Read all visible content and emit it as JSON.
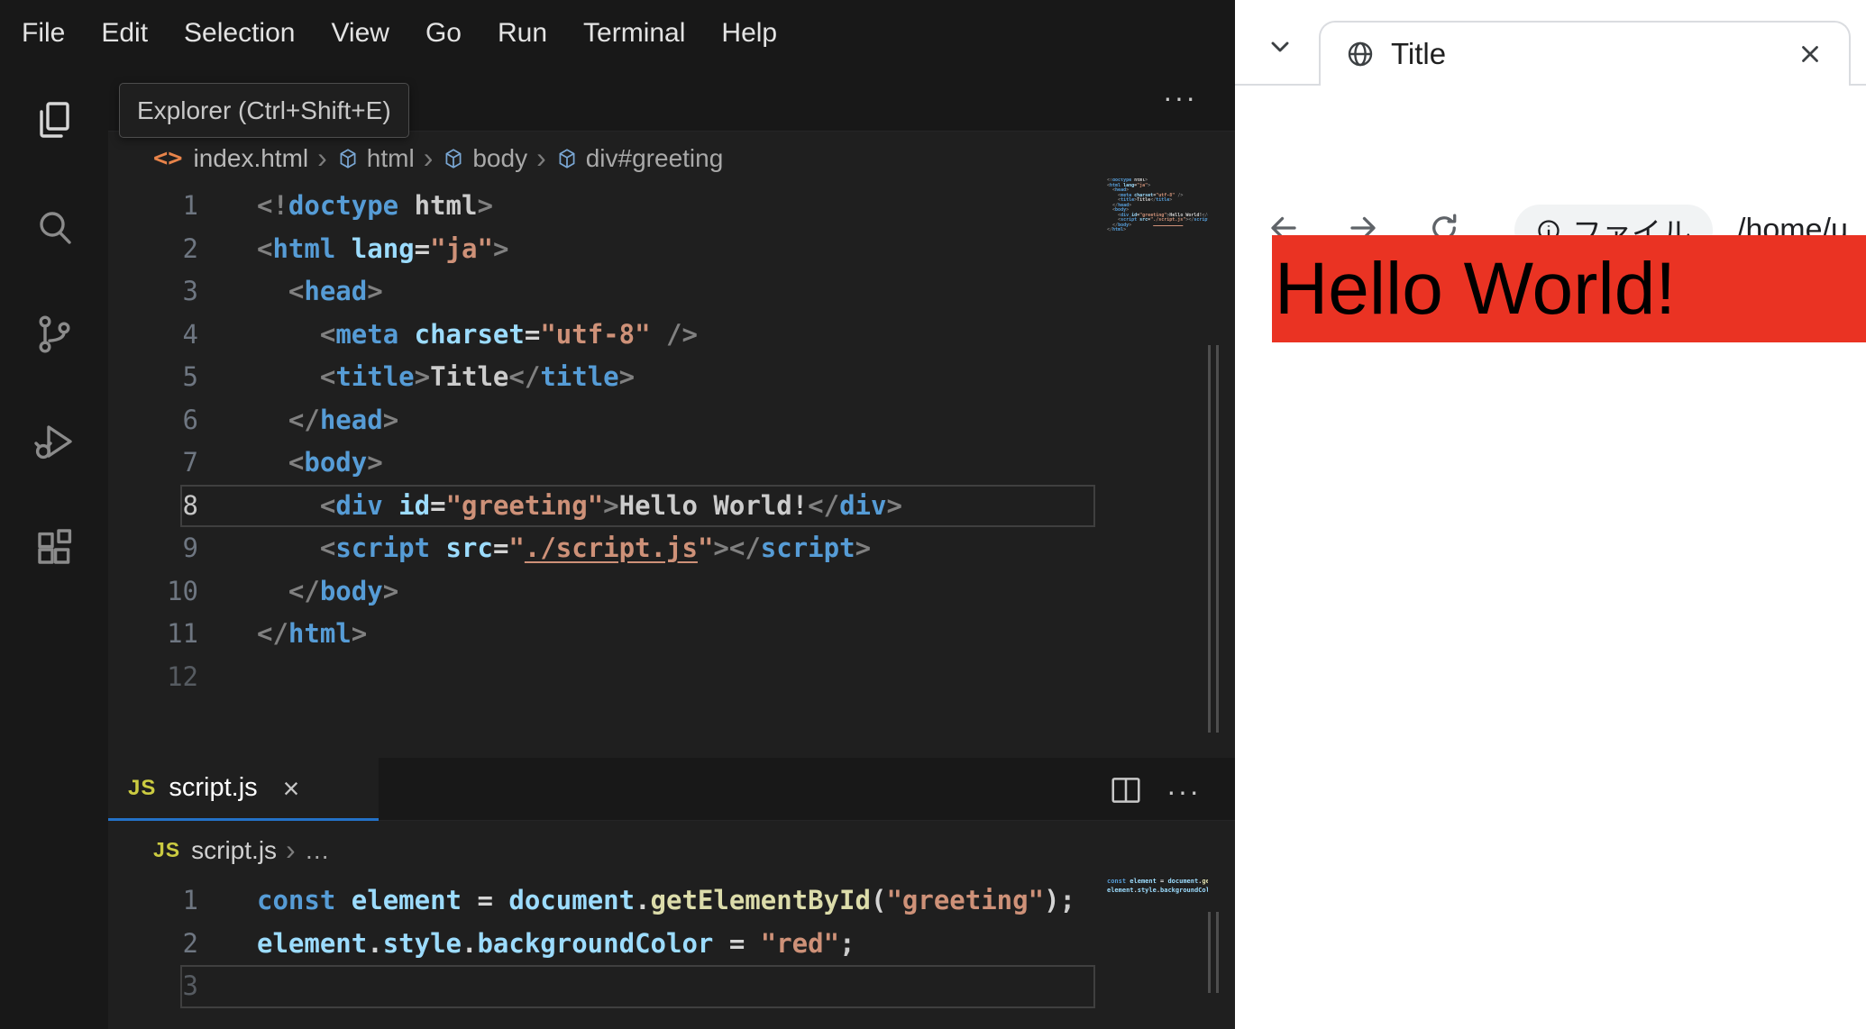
{
  "colors": {
    "accent_blue": "#2472c8",
    "banner_red": "#ea3323",
    "js_icon_yellow": "#cbcb41",
    "html_icon_orange": "#e8844a"
  },
  "vscode": {
    "menu": {
      "items": [
        "File",
        "Edit",
        "Selection",
        "View",
        "Go",
        "Run",
        "Terminal",
        "Help"
      ]
    },
    "activity_bar": {
      "tooltip": "Explorer (Ctrl+Shift+E)",
      "items": [
        "explorer",
        "search",
        "source-control",
        "run-and-debug",
        "extensions"
      ]
    },
    "ui": {
      "more": "···",
      "close_glyph": "×",
      "breadcrumb_separator": "›",
      "html_icon_glyph": "<>"
    },
    "html_editor": {
      "breadcrumb": {
        "file": "index.html",
        "path": [
          "html",
          "body",
          "div#greeting"
        ]
      },
      "lines": [
        {
          "n": "1",
          "tokens": [
            [
              "p",
              "<!"
            ],
            [
              "tag",
              "doctype"
            ],
            [
              "plain",
              " html"
            ],
            [
              "p",
              ">"
            ]
          ]
        },
        {
          "n": "2",
          "tokens": [
            [
              "p",
              "<"
            ],
            [
              "tag",
              "html"
            ],
            [
              "plain",
              " "
            ],
            [
              "attr",
              "lang"
            ],
            [
              "op",
              "="
            ],
            [
              "str",
              "\"ja\""
            ],
            [
              "p",
              ">"
            ]
          ]
        },
        {
          "n": "3",
          "tokens": [
            [
              "plain",
              "  "
            ],
            [
              "p",
              "<"
            ],
            [
              "tag",
              "head"
            ],
            [
              "p",
              ">"
            ]
          ]
        },
        {
          "n": "4",
          "tokens": [
            [
              "plain",
              "    "
            ],
            [
              "p",
              "<"
            ],
            [
              "tag",
              "meta"
            ],
            [
              "plain",
              " "
            ],
            [
              "attr",
              "charset"
            ],
            [
              "op",
              "="
            ],
            [
              "str",
              "\"utf-8\""
            ],
            [
              "plain",
              " "
            ],
            [
              "p",
              "/>"
            ]
          ]
        },
        {
          "n": "5",
          "tokens": [
            [
              "plain",
              "    "
            ],
            [
              "p",
              "<"
            ],
            [
              "tag",
              "title"
            ],
            [
              "p",
              ">"
            ],
            [
              "plain",
              "Title"
            ],
            [
              "p",
              "</"
            ],
            [
              "tag",
              "title"
            ],
            [
              "p",
              ">"
            ]
          ]
        },
        {
          "n": "6",
          "tokens": [
            [
              "plain",
              "  "
            ],
            [
              "p",
              "</"
            ],
            [
              "tag",
              "head"
            ],
            [
              "p",
              ">"
            ]
          ]
        },
        {
          "n": "7",
          "tokens": [
            [
              "plain",
              "  "
            ],
            [
              "p",
              "<"
            ],
            [
              "tag",
              "body"
            ],
            [
              "p",
              ">"
            ]
          ]
        },
        {
          "n": "8",
          "current": true,
          "tokens": [
            [
              "plain",
              "    "
            ],
            [
              "p",
              "<"
            ],
            [
              "tag",
              "div"
            ],
            [
              "plain",
              " "
            ],
            [
              "attr",
              "id"
            ],
            [
              "op",
              "="
            ],
            [
              "str",
              "\"greeting\""
            ],
            [
              "p",
              ">"
            ],
            [
              "plain",
              "Hello World!"
            ],
            [
              "p",
              "</"
            ],
            [
              "tag",
              "div"
            ],
            [
              "p",
              ">"
            ]
          ]
        },
        {
          "n": "9",
          "tokens": [
            [
              "plain",
              "    "
            ],
            [
              "p",
              "<"
            ],
            [
              "tag",
              "script"
            ],
            [
              "plain",
              " "
            ],
            [
              "attr",
              "src"
            ],
            [
              "op",
              "="
            ],
            [
              "str",
              "\""
            ],
            [
              "link",
              "./script.js"
            ],
            [
              "str",
              "\""
            ],
            [
              "p",
              "></"
            ],
            [
              "tag",
              "script"
            ],
            [
              "p",
              ">"
            ]
          ]
        },
        {
          "n": "10",
          "tokens": [
            [
              "plain",
              "  "
            ],
            [
              "p",
              "</"
            ],
            [
              "tag",
              "body"
            ],
            [
              "p",
              ">"
            ]
          ]
        },
        {
          "n": "11",
          "tokens": [
            [
              "p",
              "</"
            ],
            [
              "tag",
              "html"
            ],
            [
              "p",
              ">"
            ]
          ]
        },
        {
          "n": "12",
          "dim": true,
          "tokens": []
        }
      ]
    },
    "panel": {
      "tab": {
        "icon_text": "JS",
        "label": "script.js"
      },
      "breadcrumb": {
        "icon_text": "JS",
        "file": "script.js",
        "more": "…"
      },
      "lines": [
        {
          "n": "1",
          "tokens": [
            [
              "kw",
              "const"
            ],
            [
              "plain",
              " "
            ],
            [
              "attr",
              "element"
            ],
            [
              "op",
              " = "
            ],
            [
              "attr",
              "document"
            ],
            [
              "op",
              "."
            ],
            [
              "fn",
              "getElementById"
            ],
            [
              "op",
              "("
            ],
            [
              "str",
              "\"greeting\""
            ],
            [
              "op",
              ")"
            ],
            [
              "plain",
              ";"
            ]
          ]
        },
        {
          "n": "2",
          "tokens": [
            [
              "attr",
              "element"
            ],
            [
              "op",
              "."
            ],
            [
              "attr",
              "style"
            ],
            [
              "op",
              "."
            ],
            [
              "attr",
              "backgroundColor"
            ],
            [
              "op",
              " = "
            ],
            [
              "str",
              "\"red\""
            ],
            [
              "plain",
              ";"
            ]
          ]
        },
        {
          "n": "3",
          "dim": true,
          "current": true,
          "tokens": []
        }
      ]
    }
  },
  "browser": {
    "tab": {
      "title": "Title"
    },
    "toolbar": {
      "chip_label": "ファイル",
      "address": "/home/u"
    },
    "page": {
      "heading": "Hello World!",
      "heading_bg": "#ea3323"
    }
  }
}
